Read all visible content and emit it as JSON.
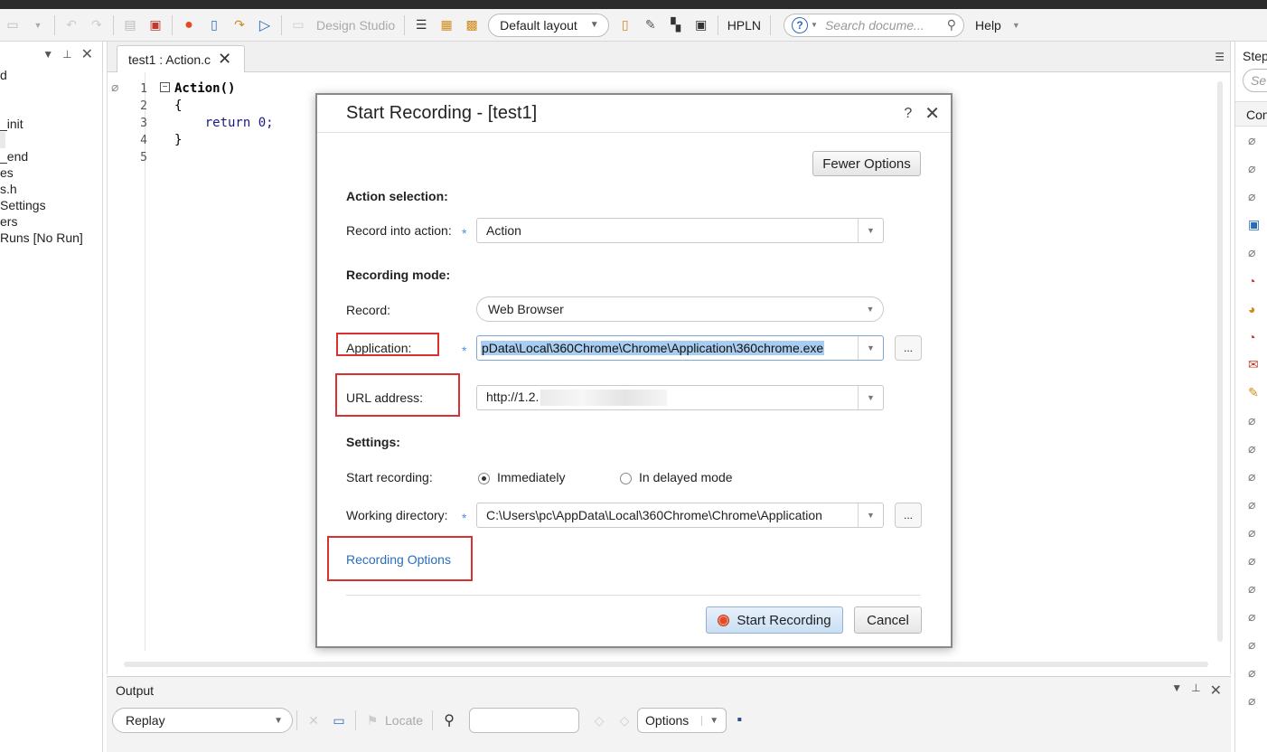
{
  "toolbar": {
    "design_studio": "Design Studio",
    "layout": "Default layout",
    "hpln": "HPLN",
    "search_placeholder": "Search docume...",
    "help": "Help"
  },
  "left_panel": {
    "items": [
      "d",
      "",
      "",
      "_init",
      "",
      "_end",
      "es",
      "s.h",
      " Settings",
      "ers",
      "Runs [No Run]"
    ]
  },
  "editor": {
    "tab_label": "test1 : Action.c",
    "line_numbers": [
      "1",
      "2",
      "3",
      "4",
      "5"
    ],
    "lines": [
      "Action()",
      "{",
      "    return 0;",
      "}",
      ""
    ]
  },
  "right_panel": {
    "title": "Steps",
    "search": "Se",
    "sub_title": "Con"
  },
  "output": {
    "title": "Output",
    "replay": "Replay",
    "locate": "Locate",
    "options": "Options"
  },
  "dialog": {
    "title": "Start Recording - [test1]",
    "help": "?",
    "fewer_options": "Fewer Options",
    "action_selection": "Action selection:",
    "record_into_action_label": "Record into action:",
    "record_into_action_value": "Action",
    "recording_mode": "Recording mode:",
    "record_label": "Record:",
    "record_value": "Web Browser",
    "application_label": "Application:",
    "application_value": "pData\\Local\\360Chrome\\Chrome\\Application\\360chrome.exe",
    "url_label": "URL address:",
    "url_value": "http://1.2.",
    "settings": "Settings:",
    "start_recording_label": "Start recording:",
    "immediately": "Immediately",
    "delayed": "In delayed mode",
    "working_dir_label": "Working directory:",
    "working_dir_value": "C:\\Users\\pc\\AppData\\Local\\360Chrome\\Chrome\\Application",
    "browse": "...",
    "recording_options": "Recording Options",
    "start_button": "Start Recording",
    "cancel_button": "Cancel"
  }
}
